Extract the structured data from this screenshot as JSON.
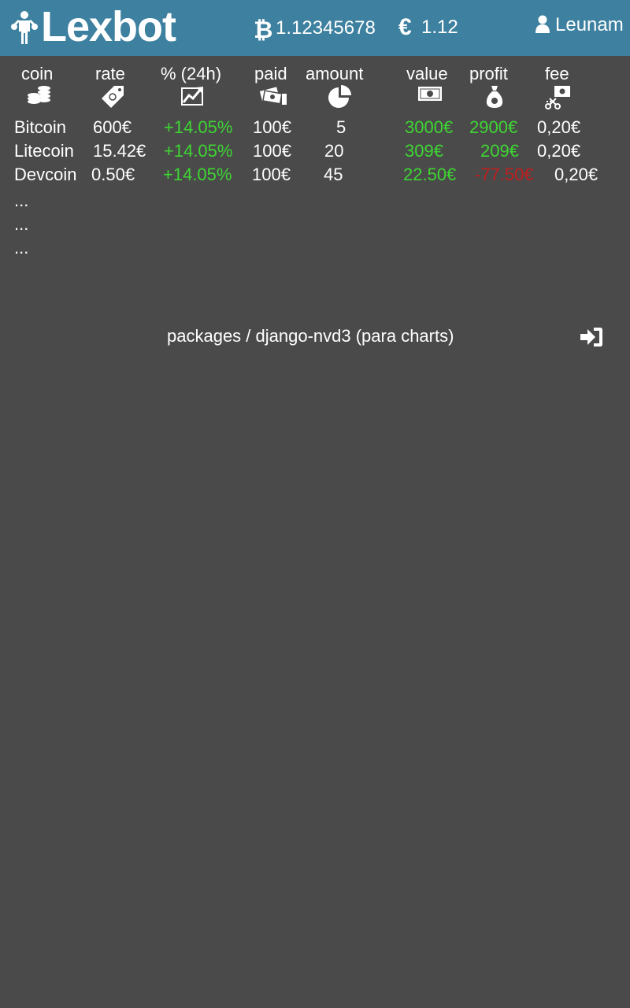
{
  "header": {
    "app_name": "Lexbot",
    "btc_balance": "1.12345678",
    "eur_symbol": "€",
    "eur_balance": "1.12",
    "user_name": "Leunam",
    "icons": {
      "logo": "man-with-money-bags-icon",
      "btc": "bitcoin-icon",
      "eur": "euro-icon",
      "user": "user-icon"
    }
  },
  "table": {
    "columns": [
      {
        "label": "coin",
        "icon": "coins-stack-icon"
      },
      {
        "label": "rate",
        "icon": "price-tag-icon"
      },
      {
        "label": "% (24h)",
        "icon": "trend-up-icon"
      },
      {
        "label": "paid",
        "icon": "banknotes-hand-icon"
      },
      {
        "label": "amount",
        "icon": "pie-chart-icon"
      },
      {
        "label": "value",
        "icon": "banknote-icon"
      },
      {
        "label": "profit",
        "icon": "money-bag-icon"
      },
      {
        "label": "fee",
        "icon": "scissors-banknote-icon"
      }
    ],
    "rows": [
      {
        "coin": "Bitcoin",
        "rate": "600€",
        "change": "+14.05%",
        "paid": "100€",
        "amount": "5",
        "value": "3000€",
        "profit": "2900€",
        "fee": "0,20€"
      },
      {
        "coin": "Litecoin",
        "rate": "15.42€",
        "change": "+14.05%",
        "paid": "100€",
        "amount": "20",
        "value": "309€",
        "profit": "209€",
        "fee": "0,20€"
      },
      {
        "coin": "Devcoin",
        "rate": "0.50€",
        "change": "+14.05%",
        "paid": "100€",
        "amount": "45",
        "value": "22.50€",
        "profit": "-77.50€",
        "fee": "0,20€"
      }
    ],
    "ellipsis": [
      "...",
      "...",
      "..."
    ]
  },
  "footer": {
    "text": "packages / django-nvd3 (para charts)",
    "login_icon": "sign-in-icon"
  },
  "colors": {
    "header_bg": "#3d809f",
    "page_bg": "#4a4a4a",
    "positive": "#3ed633",
    "negative": "#c01e1e",
    "text": "#ffffff"
  }
}
